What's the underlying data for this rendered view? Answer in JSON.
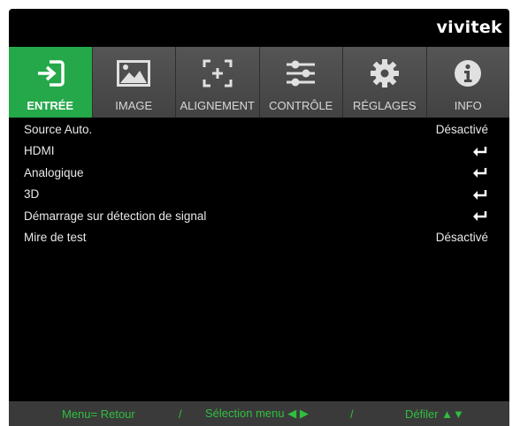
{
  "brand": "vivitek",
  "tabs": [
    {
      "label": "ENTRÉE",
      "icon": "input-icon",
      "active": true
    },
    {
      "label": "IMAGE",
      "icon": "image-icon",
      "active": false
    },
    {
      "label": "ALIGNEMENT",
      "icon": "alignment-icon",
      "active": false
    },
    {
      "label": "CONTRÔLE",
      "icon": "sliders-icon",
      "active": false
    },
    {
      "label": "RÉGLAGES",
      "icon": "gear-icon",
      "active": false
    },
    {
      "label": "INFO",
      "icon": "info-icon",
      "active": false
    }
  ],
  "items": [
    {
      "label": "Source Auto.",
      "value": "Désactivé"
    },
    {
      "label": "HDMI",
      "value": "enter-icon"
    },
    {
      "label": "Analogique",
      "value": "enter-icon"
    },
    {
      "label": "3D",
      "value": "enter-icon"
    },
    {
      "label": "Démarrage sur détection de signal",
      "value": "enter-icon"
    },
    {
      "label": "Mire de test",
      "value": "Désactivé"
    }
  ],
  "footer": {
    "back": "Menu= Retour",
    "sep1": "/",
    "select": "Sélection menu ◀ ▶",
    "sep2": "/",
    "scroll": "Défiler ▲▼"
  },
  "colors": {
    "accent": "#25a84a",
    "footer_text": "#2fbf3f"
  }
}
